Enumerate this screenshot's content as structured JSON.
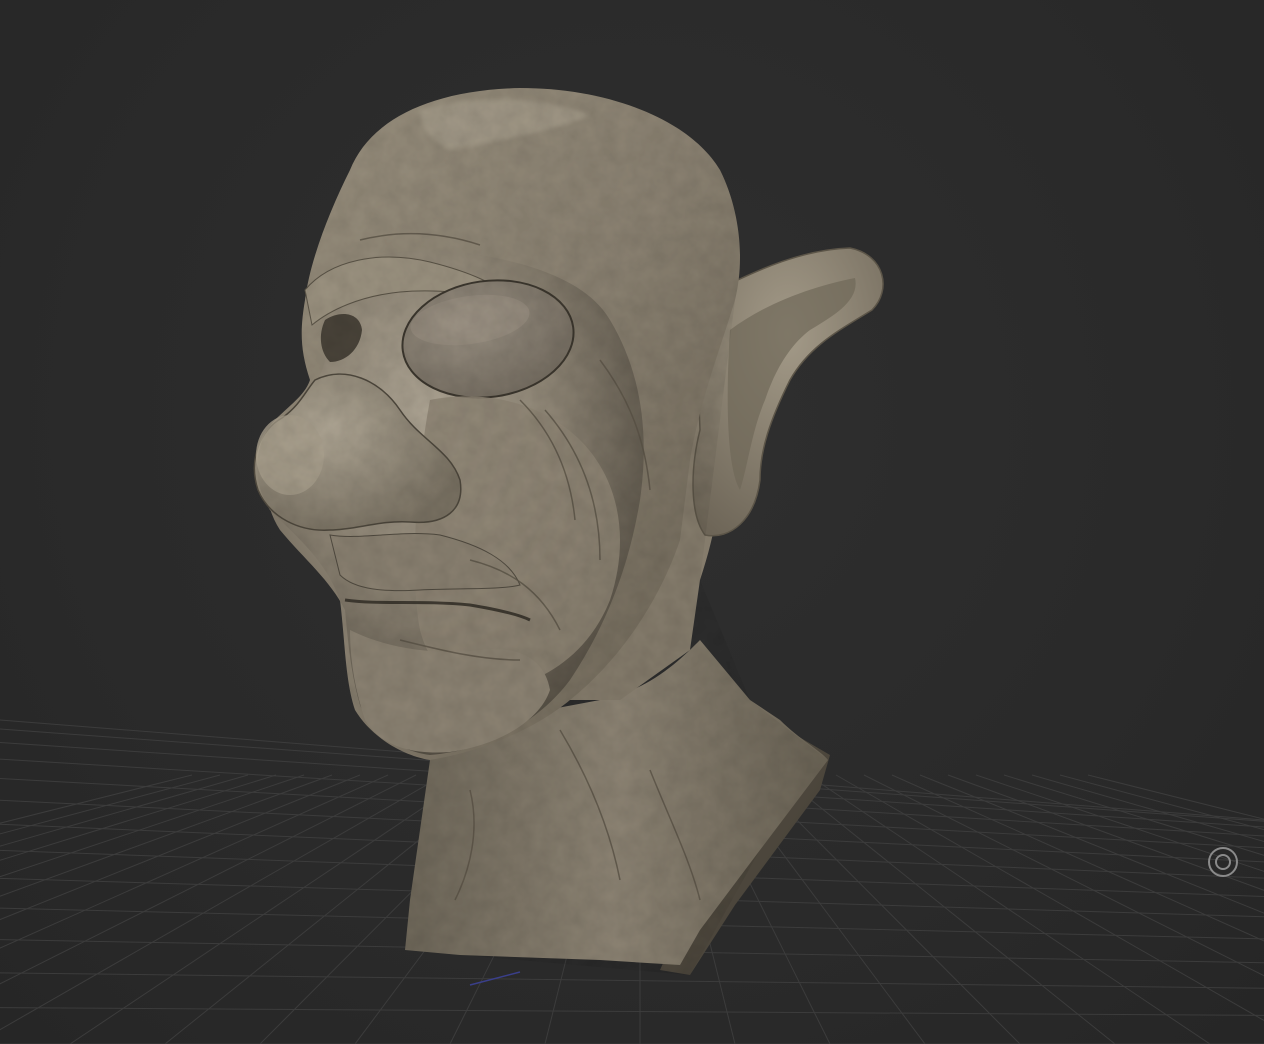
{
  "viewport": {
    "background_color": "#2b2b2b",
    "grid_color": "#3c3c3c",
    "model_color": "#847b6c",
    "model_highlight_color": "#b4ab9a",
    "model_shadow_color": "#3e392f",
    "eye_patch_color": "#8e8578"
  },
  "model": {
    "description_icon": "sculpted-head-bust"
  },
  "controls": {
    "orbit_icon": "orbit-target-icon"
  }
}
